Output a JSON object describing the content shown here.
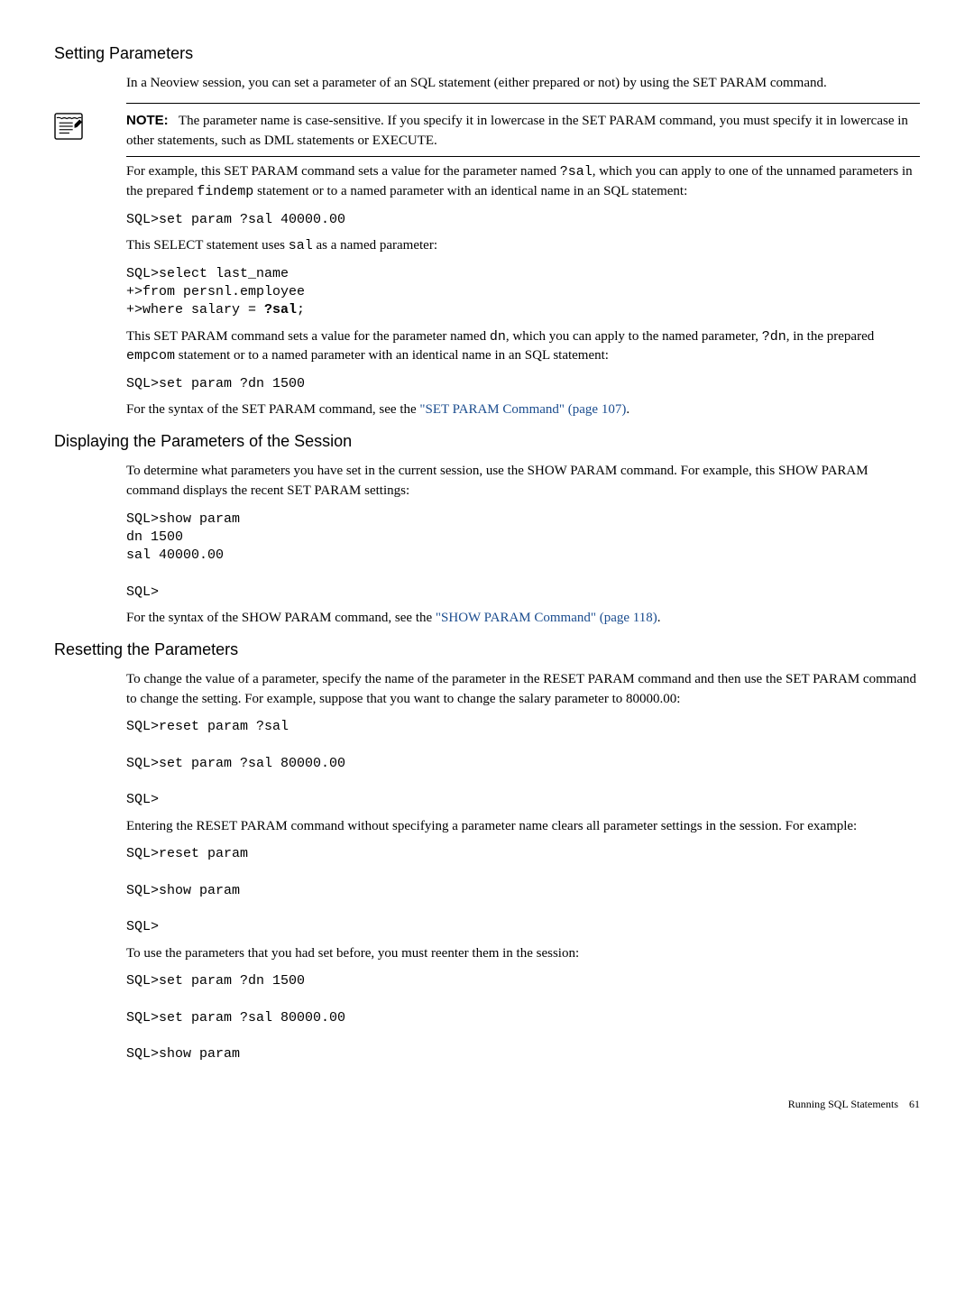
{
  "sections": {
    "setting_params": {
      "heading": "Setting Parameters",
      "p1": "In a Neoview session, you can set a parameter of an SQL statement (either prepared or not) by using the SET PARAM command.",
      "note_label": "NOTE:",
      "note_body": "The parameter name is case-sensitive. If you specify it in lowercase in the SET PARAM command, you must specify it in lowercase in other statements, such as DML statements or EXECUTE.",
      "p2_pre": "For example, this SET PARAM command sets a value for the parameter named ",
      "p2_code1": "?sal",
      "p2_mid1": ", which you can apply to one of the unnamed parameters in the prepared ",
      "p2_code2": "findemp",
      "p2_mid2": " statement or to a named parameter with an identical name in an SQL statement:",
      "code1": "SQL>set param ?sal 40000.00",
      "p3_pre": "This SELECT statement uses ",
      "p3_code": "sal",
      "p3_post": " as a named parameter:",
      "code2a": "SQL>select last_name\n+>from persnl.employee\n+>where salary = ",
      "code2b": "?sal",
      "code2c": ";",
      "p4_pre": "This SET PARAM command sets a value for the parameter named ",
      "p4_code1": "dn",
      "p4_mid1": ", which you can apply to the named parameter, ",
      "p4_code2": "?dn",
      "p4_mid2": ", in the prepared ",
      "p4_code3": "empcom",
      "p4_mid3": " statement or to a named parameter with an identical name in an SQL statement:",
      "code3": "SQL>set param ?dn 1500",
      "p5_pre": "For the syntax of the SET PARAM command, see the ",
      "p5_link": "\"SET PARAM Command\" (page 107)",
      "p5_post": "."
    },
    "displaying": {
      "heading": "Displaying the Parameters of the Session",
      "p1": "To determine what parameters you have set in the current session, use the SHOW PARAM command. For example, this SHOW PARAM command displays the recent SET PARAM settings:",
      "code1": "SQL>show param\ndn 1500\nsal 40000.00\n\nSQL>",
      "p2_pre": "For the syntax of the SHOW PARAM command, see the ",
      "p2_link": "\"SHOW PARAM Command\" (page 118)",
      "p2_post": "."
    },
    "resetting": {
      "heading": "Resetting the Parameters",
      "p1": "To change the value of a parameter, specify the name of the parameter in the RESET PARAM command and then use the SET PARAM command to change the setting. For example, suppose that you want to change the salary parameter to 80000.00:",
      "code1": "SQL>reset param ?sal\n\nSQL>set param ?sal 80000.00\n\nSQL>",
      "p2": "Entering the RESET PARAM command without specifying a parameter name clears all parameter settings in the session. For example:",
      "code2": "SQL>reset param\n\nSQL>show param\n\nSQL>",
      "p3": "To use the parameters that you had set before, you must reenter them in the session:",
      "code3": "SQL>set param ?dn 1500\n\nSQL>set param ?sal 80000.00\n\nSQL>show param"
    }
  },
  "footer": {
    "label": "Running SQL Statements",
    "page": "61"
  }
}
